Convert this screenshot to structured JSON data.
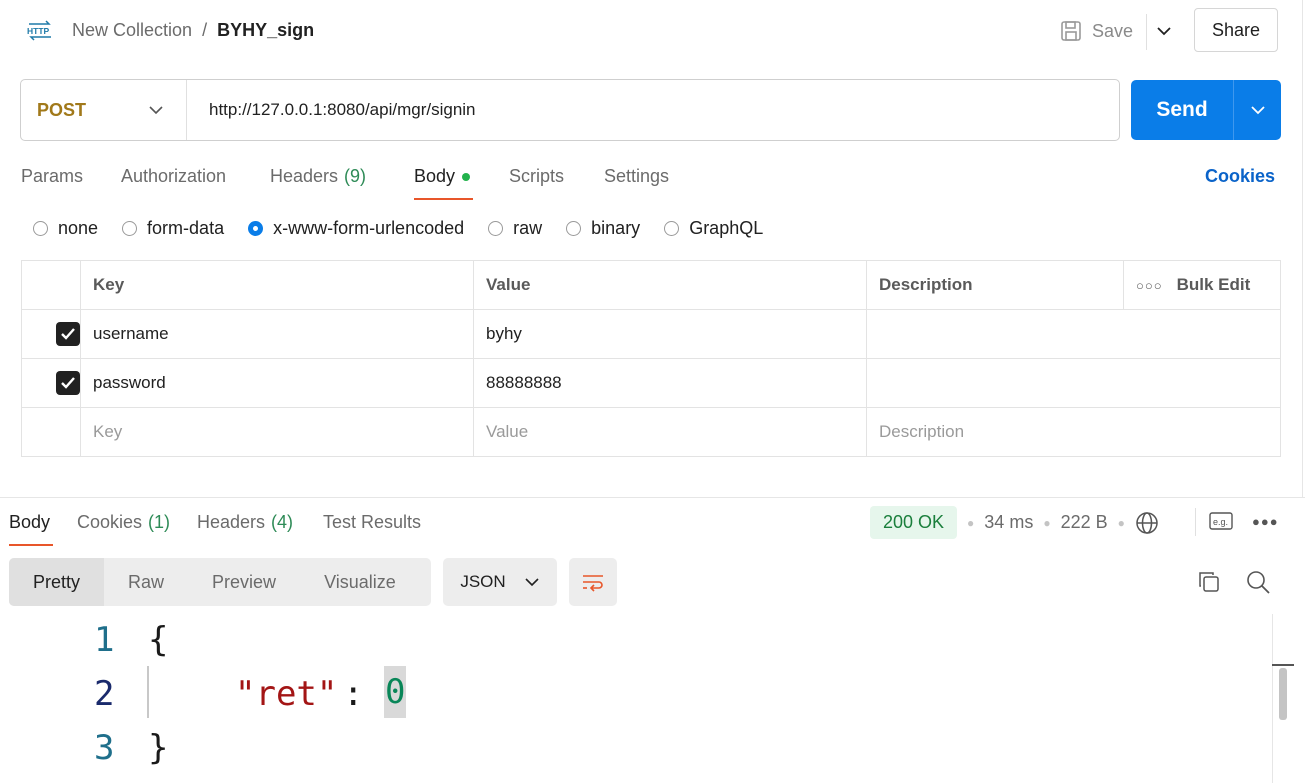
{
  "header": {
    "icon_label": "HTTP",
    "breadcrumb_parent": "New Collection",
    "breadcrumb_separator": "/",
    "breadcrumb_current": "BYHY_sign",
    "save_label": "Save",
    "share_label": "Share"
  },
  "request": {
    "method": "POST",
    "url": "http://127.0.0.1:8080/api/mgr/signin",
    "send_label": "Send"
  },
  "request_tabs": {
    "params": "Params",
    "authorization": "Authorization",
    "headers": "Headers",
    "headers_count": "(9)",
    "body": "Body",
    "scripts": "Scripts",
    "settings": "Settings",
    "cookies": "Cookies"
  },
  "body_types": {
    "none": "none",
    "form_data": "form-data",
    "urlencoded": "x-www-form-urlencoded",
    "raw": "raw",
    "binary": "binary",
    "graphql": "GraphQL",
    "selected": "x-www-form-urlencoded"
  },
  "table": {
    "headers": {
      "key": "Key",
      "value": "Value",
      "description": "Description",
      "bulk_edit": "Bulk Edit"
    },
    "rows": [
      {
        "key": "username",
        "value": "byhy",
        "description": ""
      },
      {
        "key": "password",
        "value": "88888888",
        "description": ""
      }
    ],
    "placeholders": {
      "key": "Key",
      "value": "Value",
      "description": "Description"
    }
  },
  "response_tabs": {
    "body": "Body",
    "cookies": "Cookies",
    "cookies_count": "(1)",
    "headers": "Headers",
    "headers_count": "(4)",
    "test_results": "Test Results"
  },
  "response_meta": {
    "status": "200 OK",
    "time": "34 ms",
    "size": "222 B",
    "status_color": "#1a7f3c"
  },
  "view_modes": {
    "pretty": "Pretty",
    "raw": "Raw",
    "preview": "Preview",
    "visualize": "Visualize",
    "format": "JSON"
  },
  "code": {
    "line_numbers": [
      "1",
      "2",
      "3"
    ],
    "open_brace": "{",
    "key": "\"ret\"",
    "colon": ":",
    "value": "0",
    "close_brace": "}"
  },
  "colors": {
    "accent": "#0a7de8",
    "active_tab": "#e8562a"
  }
}
